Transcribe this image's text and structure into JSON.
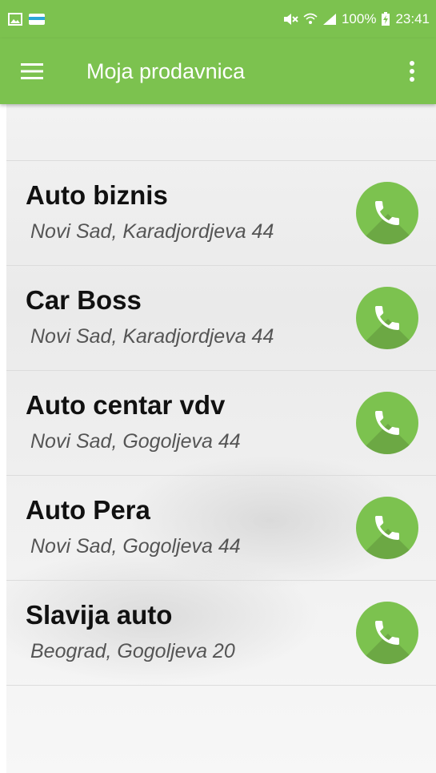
{
  "status_bar": {
    "battery": "100%",
    "time": "23:41"
  },
  "app_bar": {
    "title": "Moja prodavnica"
  },
  "stores": [
    {
      "name": "Auto biznis",
      "address": "Novi Sad, Karadjordjeva 44"
    },
    {
      "name": "Car Boss",
      "address": "Novi Sad, Karadjordjeva 44"
    },
    {
      "name": "Auto centar vdv",
      "address": "Novi Sad, Gogoljeva 44"
    },
    {
      "name": "Auto Pera",
      "address": "Novi Sad, Gogoljeva 44"
    },
    {
      "name": "Slavija auto",
      "address": "Beograd, Gogoljeva 20"
    }
  ],
  "colors": {
    "accent": "#7cc24f"
  }
}
